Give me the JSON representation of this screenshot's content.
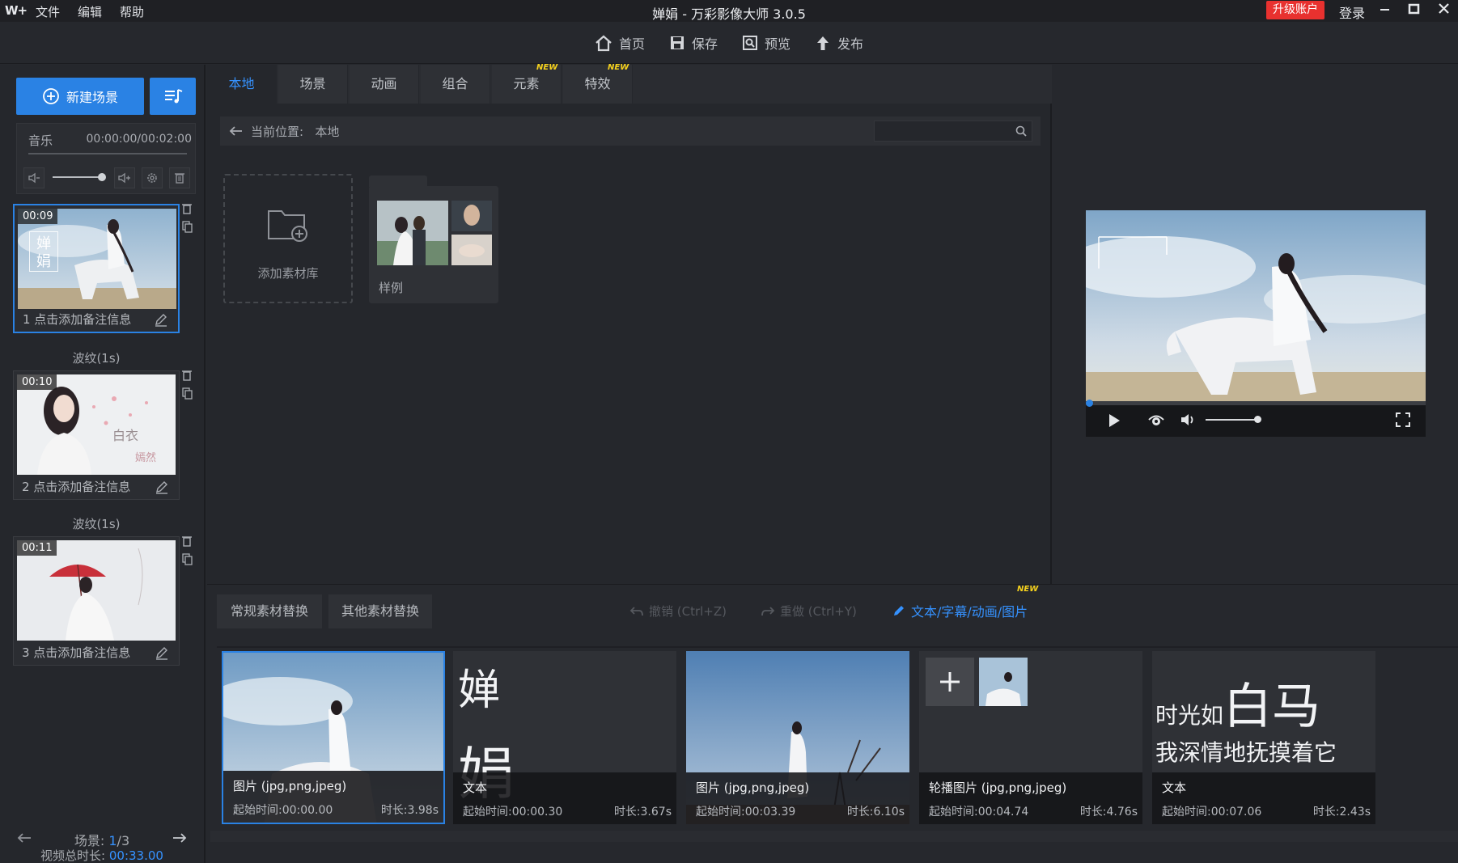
{
  "titlebar": {
    "logo": "W+",
    "menu": [
      "文件",
      "编辑",
      "帮助"
    ],
    "title": "婵娟 - 万彩影像大师 3.0.5",
    "upgrade": "升级账户",
    "login": "登录"
  },
  "toolbar": {
    "home": "首页",
    "save": "保存",
    "preview": "预览",
    "publish": "发布"
  },
  "left": {
    "new_scene": "新建场景",
    "music": {
      "label": "音乐",
      "time": "00:00:00/00:02:00"
    },
    "scenes": [
      {
        "time": "00:09",
        "note": "1   点击添加备注信息"
      },
      {
        "time": "00:10",
        "note": "2   点击添加备注信息"
      },
      {
        "time": "00:11",
        "note": "3   点击添加备注信息"
      }
    ],
    "transitions": [
      "波纹(1s)",
      "波纹(1s)"
    ],
    "scene_label": "场景: ",
    "scene_index": "1",
    "scene_total": "/3",
    "total_label": "视频总时长: ",
    "total_value": "00:33.00"
  },
  "tabs": [
    "本地",
    "场景",
    "动画",
    "组合",
    "元素",
    "特效"
  ],
  "new_badge": "NEW",
  "location": {
    "label": "当前位置:",
    "value": "本地",
    "search_placeholder": ""
  },
  "library": {
    "add": "添加素材库",
    "sample": "样例"
  },
  "bottom": {
    "tab_regular": "常规素材替换",
    "tab_other": "其他素材替换",
    "undo": "撤销 (Ctrl+Z)",
    "redo": "重做 (Ctrl+Y)",
    "edit_link": "文本/字幕/动画/图片",
    "clips": [
      {
        "type": "图片 (jpg,png,jpeg)",
        "start": "起始时间:00:00.00",
        "duration": "时长:3.98s"
      },
      {
        "type": "文本",
        "start": "起始时间:00:00.30",
        "duration": "时长:3.67s",
        "text1": "婵",
        "text2": "娟"
      },
      {
        "type": "图片 (jpg,png,jpeg)",
        "start": "起始时间:00:03.39",
        "duration": "时长:6.10s"
      },
      {
        "type": "轮播图片 (jpg,png,jpeg)",
        "start": "起始时间:00:04.74",
        "duration": "时长:4.76s"
      },
      {
        "type": "文本",
        "start": "起始时间:00:07.06",
        "duration": "时长:2.43s",
        "text1a": "时光如",
        "text1b": "白马",
        "text2": "我深情地抚摸着它"
      }
    ]
  },
  "scene2_overlay": {
    "line1": "白衣",
    "line2": "嫣然"
  },
  "scene1_overlay": "婵\n娟",
  "colors": {
    "accent": "#2a82e4",
    "upgrade": "#e8312f",
    "new_badge": "#f6d21d"
  }
}
